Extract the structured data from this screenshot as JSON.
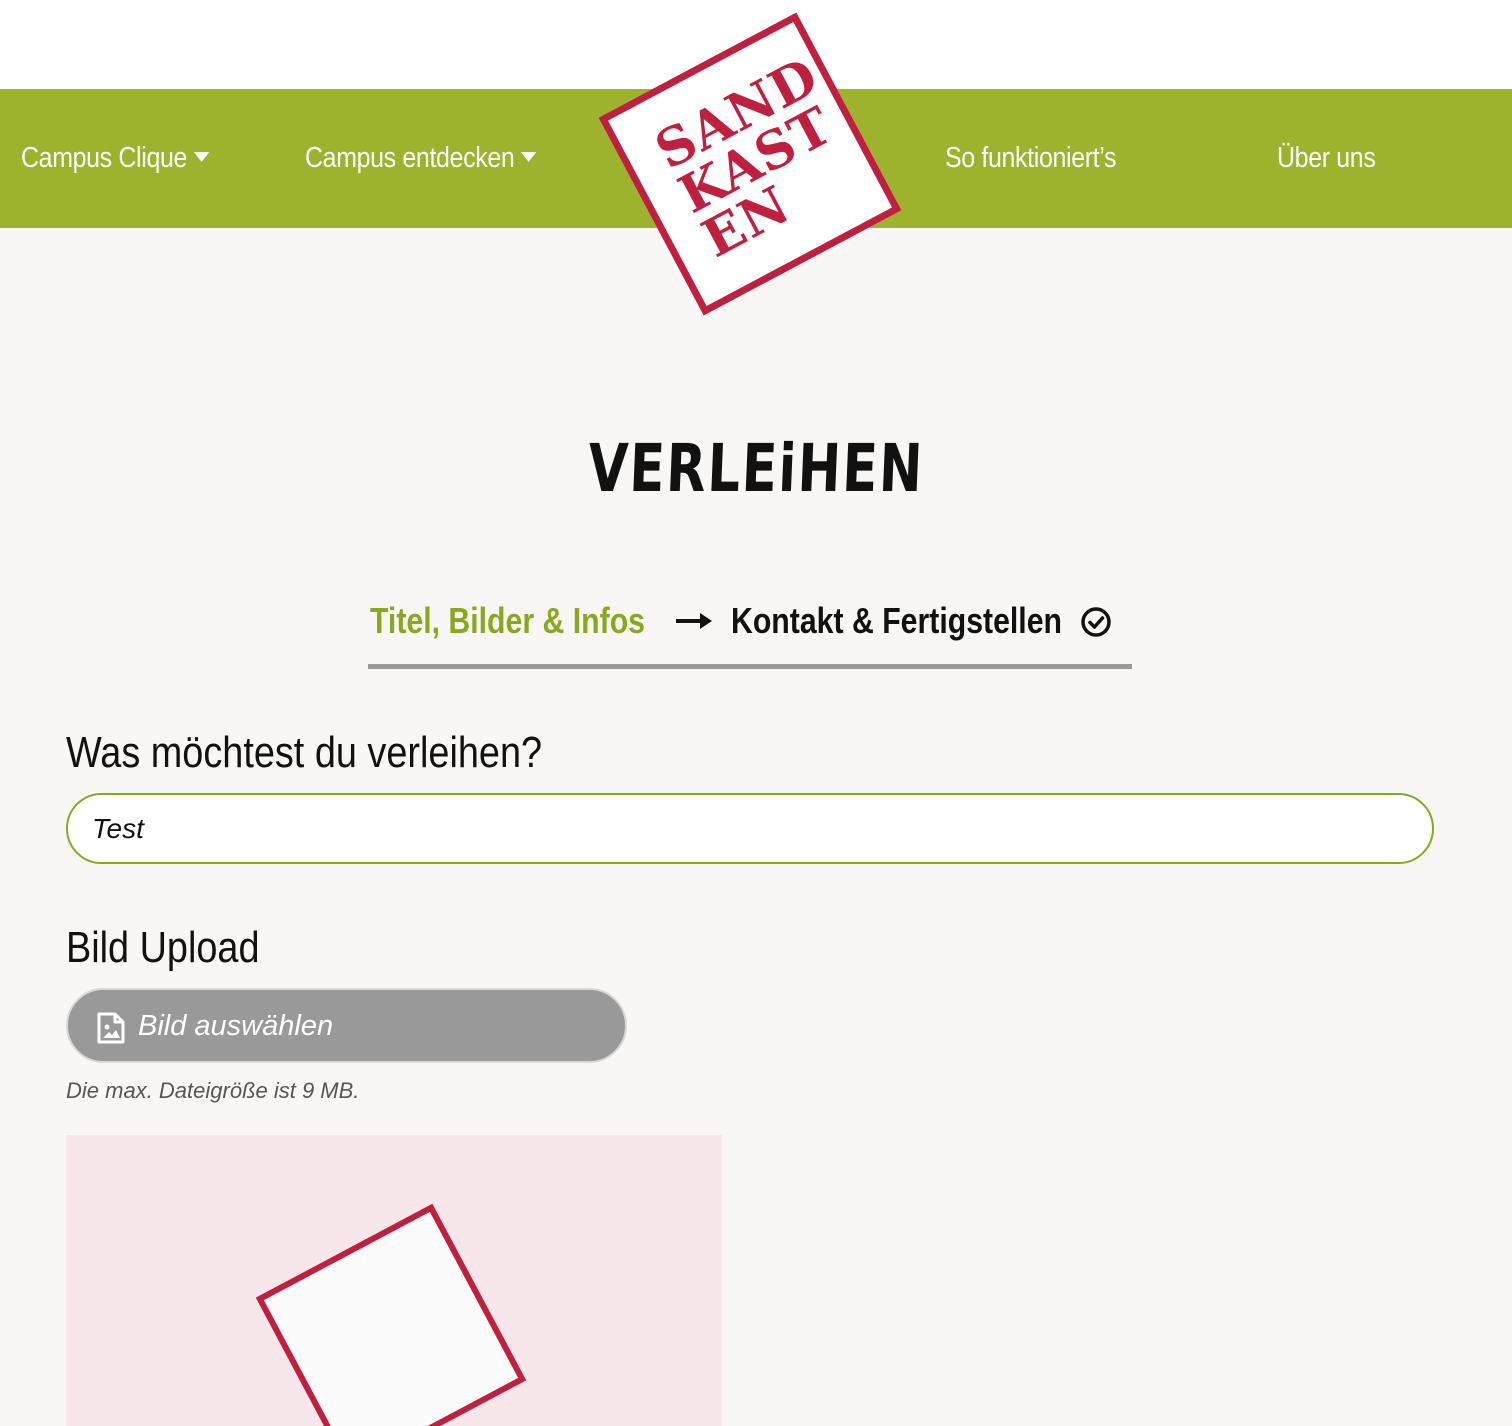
{
  "nav": {
    "items": [
      {
        "label": "Campus Clique",
        "has_dropdown": true
      },
      {
        "label": "Campus entdecken",
        "has_dropdown": true
      },
      {
        "label": "So funktioniert’s",
        "has_dropdown": false
      },
      {
        "label": "Über uns",
        "has_dropdown": false
      }
    ]
  },
  "logo": {
    "lines": [
      "SAND",
      "KAST",
      "EN"
    ],
    "color": "#c0203f"
  },
  "page": {
    "title": "VERLEiHEN"
  },
  "steps": {
    "active": "Titel, Bilder & Infos",
    "next": "Kontakt & Fertigstellen",
    "arrow_icon": "arrow-right-icon",
    "done_icon": "check-circle-icon"
  },
  "form": {
    "item_label": "Was möchtest du verleihen?",
    "item_value": "Test",
    "upload_label": "Bild Upload",
    "upload_button": "Bild auswählen",
    "upload_icon": "image-file-icon",
    "upload_hint": "Die max. Dateigröße ist 9 MB."
  },
  "colors": {
    "accent_green": "#9db32d",
    "brand_red": "#c0203f",
    "background": "#f8f7f6",
    "button_gray": "#999999"
  }
}
